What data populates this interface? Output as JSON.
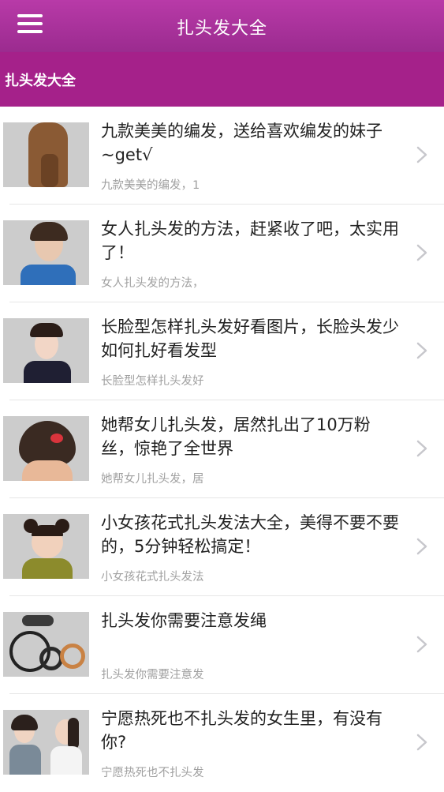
{
  "header": {
    "title": "扎头发大全",
    "menu_icon": "hamburger-menu-icon",
    "bg_color": "#a8329c"
  },
  "section": {
    "label": "扎头发大全",
    "bg_color": "#a5218a"
  },
  "articles": [
    {
      "title": "九款美美的编发，送给喜欢编发的妹子~get√",
      "summary": "九款美美的编发，1",
      "thumbnail": "braided-hair-photo"
    },
    {
      "title": "女人扎头发的方法，赶紧收了吧，太实用了！",
      "summary": "女人扎头发的方法，",
      "thumbnail": "woman-updo-photo"
    },
    {
      "title": "长脸型怎样扎头发好看图片，长脸头发少如何扎好看发型",
      "summary": "长脸型怎样扎头发好",
      "thumbnail": "long-face-hairstyle-photo"
    },
    {
      "title": "她帮女儿扎头发，居然扎出了10万粉丝，惊艳了全世界",
      "summary": "她帮女儿扎头发，居",
      "thumbnail": "girl-braids-photo"
    },
    {
      "title": "小女孩花式扎头发法大全，美得不要不要的，5分钟轻松搞定！",
      "summary": "小女孩花式扎头发法",
      "thumbnail": "little-girl-buns-photo"
    },
    {
      "title": "扎头发你需要注意发绳",
      "summary": "扎头发你需要注意发",
      "thumbnail": "hair-ties-photo"
    },
    {
      "title": "宁愿热死也不扎头发的女生里，有没有你?",
      "summary": "宁愿热死也不扎头发",
      "thumbnail": "women-ponytail-photo"
    }
  ]
}
